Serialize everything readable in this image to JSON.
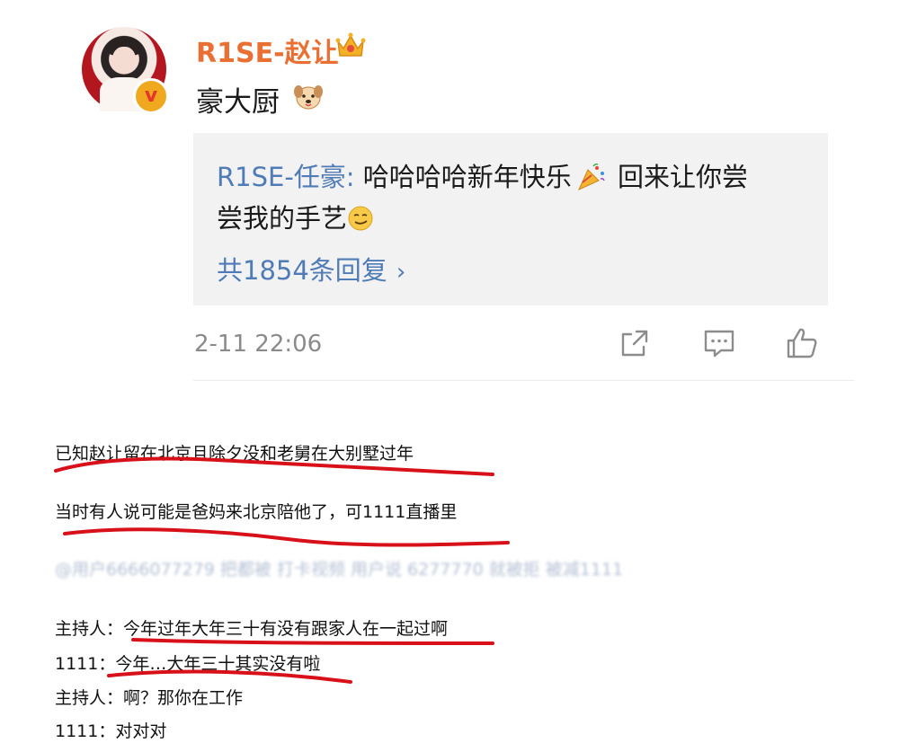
{
  "post": {
    "username": "R1SE-赵让",
    "text": "豪大厨",
    "reply": {
      "author": "R1SE-任豪:",
      "line1_text": " 哈哈哈哈新年快乐",
      "line1_after": " 回来让你尝",
      "line2_text": "尝我的手艺",
      "count_label": "共1854条回复",
      "chevron": "›"
    },
    "timestamp": "2-11 22:06"
  },
  "icons": {
    "verified": "verified-v-badge",
    "crown": "crown-icon",
    "dog": "dog-emoji",
    "party": "party-popper-emoji",
    "smirk": "smirk-emoji",
    "share": "share-icon",
    "comment": "comment-icon",
    "like": "thumbs-up-icon"
  },
  "notes": {
    "line1": "已知赵让留在北京且除夕没和老舅在大别墅过年",
    "line2": "当时有人说可能是爸妈来北京陪他了，可1111直播里",
    "blurred_mention": "@用户6666077279 把都被 打卡视频 用户说 6277770 就被拒  被减1111",
    "line3": "主持人：今年过年大年三十有没有跟家人在一起过啊",
    "line4": "1111：今年…大年三十其实没有啦",
    "line5": "主持人：啊？那你在工作",
    "line6": "1111：对对对"
  },
  "colors": {
    "username": "#e96f33",
    "link_blue": "#4f7bb6",
    "reply_bg": "#f2f2f2",
    "annotation_red": "#d8101a",
    "timestamp_gray": "#8a8a8a"
  }
}
